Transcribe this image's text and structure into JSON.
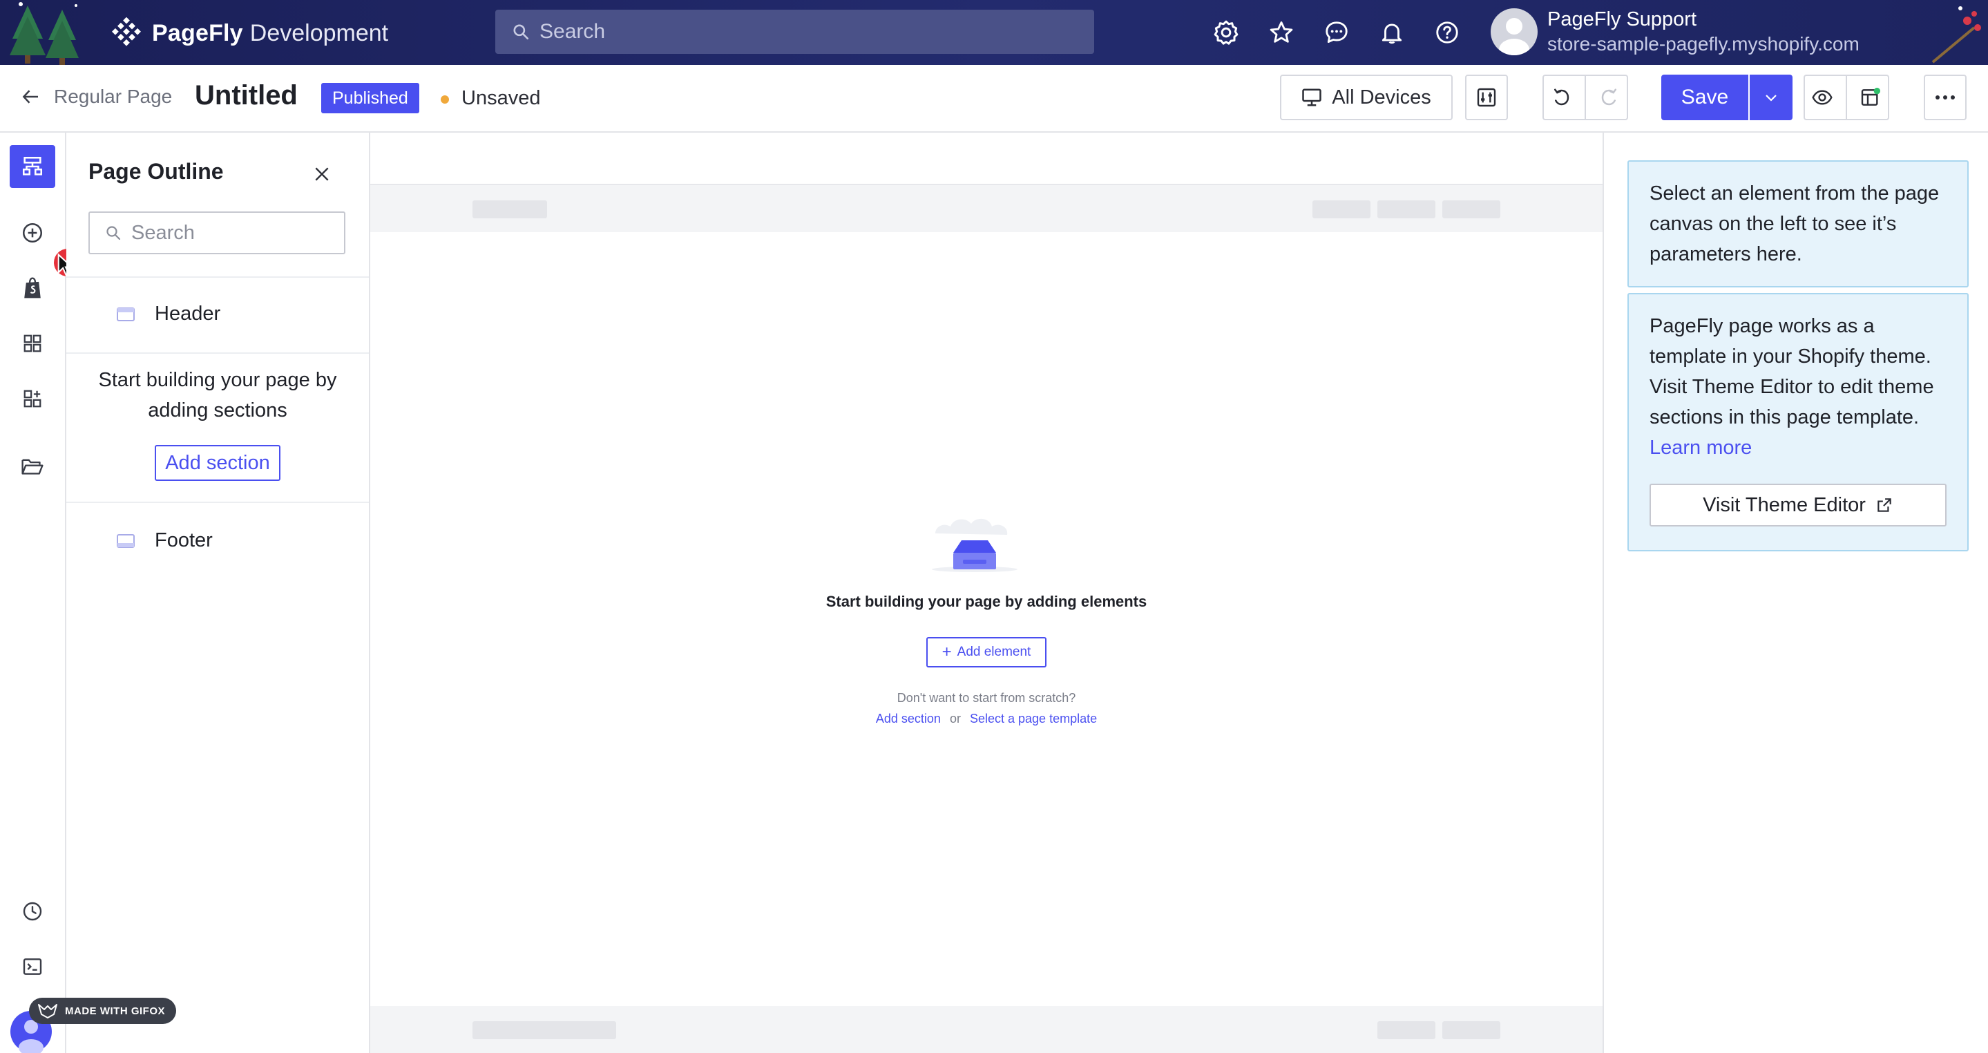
{
  "header": {
    "brand": "PageFly",
    "environment": "Development",
    "search_placeholder": "Search",
    "icons": [
      "settings-icon",
      "star-icon",
      "chat-icon",
      "bell-icon",
      "help-icon"
    ],
    "user_name": "PageFly Support",
    "user_store": "store-sample-pagefly.myshopify.com"
  },
  "toolbar": {
    "back_label": "Regular Page",
    "page_title": "Untitled",
    "status_badge": "Published",
    "save_state": "Unsaved",
    "devices_label": "All Devices",
    "save_label": "Save"
  },
  "rail": {
    "items": [
      "page-outline-icon",
      "add-icon",
      "shopify-icon",
      "grid-icon",
      "apps-icon",
      "folder-icon",
      "history-icon",
      "terminal-icon"
    ]
  },
  "outline": {
    "title": "Page Outline",
    "search_placeholder": "Search",
    "header_label": "Header",
    "empty_text": "Start building your page by adding sections",
    "add_section_label": "Add section",
    "footer_label": "Footer"
  },
  "canvas": {
    "empty_title": "Start building your page by adding elements",
    "add_element_label": "Add element",
    "scratch_text": "Don't want to start from scratch?",
    "link_add_section": "Add section",
    "or_text": "or",
    "link_template": "Select a page template"
  },
  "inspector": {
    "hint": "Select an element from the page canvas on the left to see it’s parameters here.",
    "theme_text": "PageFly page works as a template in your Shopify theme. Visit Theme Editor to edit theme sections in this page template.",
    "learn_more": "Learn more",
    "theme_button": "Visit Theme Editor"
  },
  "watermark": "MADE WITH GIFOX",
  "colors": {
    "accent": "#4a4ff0",
    "header_bg": "#1d2460",
    "info_bg": "#e6f3fb",
    "unsaved_dot": "#f0a83a"
  }
}
